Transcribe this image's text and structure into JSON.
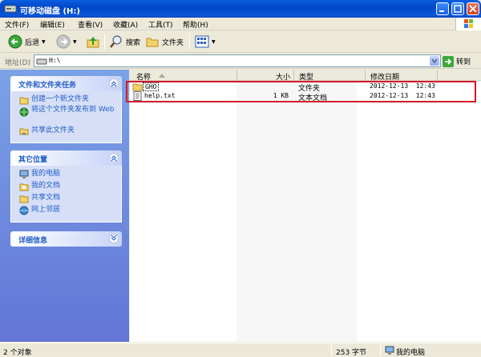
{
  "window": {
    "title": "可移动磁盘 (H:)"
  },
  "menu": [
    "文件(F)",
    "编辑(E)",
    "查看(V)",
    "收藏(A)",
    "工具(T)",
    "帮助(H)"
  ],
  "toolbar": {
    "back": "后退",
    "search": "搜索",
    "folders": "文件夹"
  },
  "address": {
    "label": "地址(D)",
    "value": "H:\\",
    "go": "转到"
  },
  "tasks": {
    "title": "文件和文件夹任务",
    "items": [
      "创建一个新文件夹",
      "将这个文件夹发布到 Web",
      "共享此文件夹"
    ]
  },
  "places": {
    "title": "其它位置",
    "items": [
      "我的电脑",
      "我的文档",
      "共享文档",
      "网上邻居"
    ]
  },
  "details": {
    "title": "详细信息"
  },
  "columns": {
    "name": "名称",
    "size": "大小",
    "type": "类型",
    "date": "修改日期"
  },
  "files": [
    {
      "name": "GHO",
      "size": "",
      "type": "文件夹",
      "date": "2012-12-13  12:43",
      "icon": "folder-icon"
    },
    {
      "name": "help.txt",
      "size": "1 KB",
      "type": "文本文档",
      "date": "2012-12-13  12:43",
      "icon": "text-file-icon"
    }
  ],
  "status": {
    "objects": "2 个对象",
    "bytes": "253 字节",
    "location": "我的电脑"
  },
  "colors": {
    "titlebar": "#0a56d8",
    "taskpane": "#6f8ddd",
    "taskLink": "#215dc6",
    "highlight": "#d4192a"
  }
}
